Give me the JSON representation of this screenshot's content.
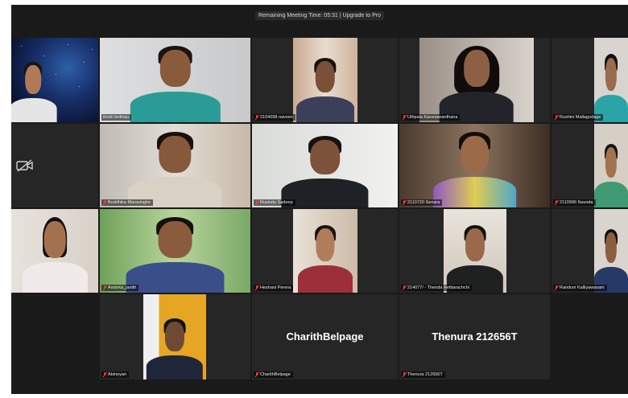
{
  "topbar": {
    "meeting_status": "Remaining Meeting Time: 05:31 | Upgrade to Pro"
  },
  "participants": [
    {
      "name": ""
    },
    {
      "name": "ilindri bothoju"
    },
    {
      "name": "2104098 naveen"
    },
    {
      "name": "Uthpala Karunawardhana"
    },
    {
      "name": "Rushini Mallagodage"
    },
    {
      "name": ""
    },
    {
      "name": "Buddhika Marasinghe"
    },
    {
      "name": "Rusindu Sadeep"
    },
    {
      "name": "2110720 Senara"
    },
    {
      "name": "2110996 Navoda"
    },
    {
      "name": ""
    },
    {
      "name": "Avishka_janith"
    },
    {
      "name": "Heshani Perera"
    },
    {
      "name": "214077/ - Theoda Hettiarachchi"
    },
    {
      "name": "Randuni Kalliyawasam"
    },
    {
      "name": "Abineyan"
    },
    {
      "name": "CharithBelpage",
      "display_name": "CharithBelpage"
    },
    {
      "name": "Thenura 212656T",
      "display_name": "Thenura 212656T"
    }
  ]
}
